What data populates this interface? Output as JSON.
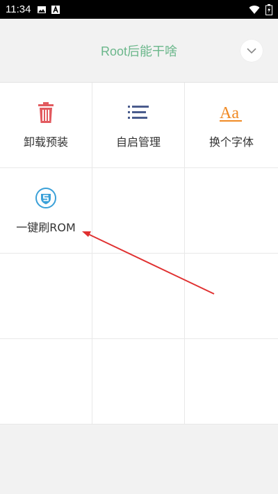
{
  "status_bar": {
    "time": "11:34",
    "icons": [
      "image-icon",
      "a-notification-icon",
      "wifi-icon",
      "battery-icon"
    ]
  },
  "header": {
    "title": "Root后能干啥",
    "collapse_icon": "chevron-down-icon"
  },
  "grid": {
    "items": [
      {
        "label": "卸载预装",
        "icon": "trash-icon",
        "color": "#e25a5f"
      },
      {
        "label": "自启管理",
        "icon": "list-icon",
        "color": "#4a5c8d"
      },
      {
        "label": "换个字体",
        "icon": "font-aa-icon",
        "color": "#f08a24"
      },
      {
        "label": "一键刷ROM",
        "icon": "shield-s-icon",
        "color": "#3aa0d8"
      }
    ]
  },
  "colors": {
    "title": "#6bb78b",
    "arrow": "#e03030"
  }
}
